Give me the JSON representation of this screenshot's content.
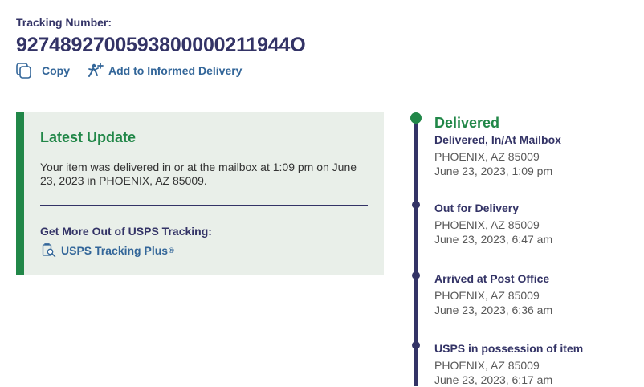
{
  "header": {
    "tracking_label": "Tracking Number:",
    "tracking_number": "9274892700593800000211944O",
    "copy_label": "Copy",
    "informed_label": "Add to Informed Delivery"
  },
  "latest_update": {
    "title": "Latest Update",
    "text": "Your item was delivered in or at the mailbox at 1:09 pm on June 23, 2023 in PHOENIX, AZ 85009.",
    "more_title": "Get More Out of USPS Tracking:",
    "plus_label": "USPS Tracking Plus",
    "plus_mark": "®"
  },
  "timeline": {
    "events": [
      {
        "status": "Delivered",
        "detail": "Delivered, In/At Mailbox",
        "location": "PHOENIX, AZ 85009",
        "datetime": "June 23, 2023, 1:09 pm"
      },
      {
        "status": "Out for Delivery",
        "location": "PHOENIX, AZ 85009",
        "datetime": "June 23, 2023, 6:47 am"
      },
      {
        "status": "Arrived at Post Office",
        "location": "PHOENIX, AZ 85009",
        "datetime": "June 23, 2023, 6:36 am"
      },
      {
        "status": "USPS in possession of item",
        "location": "PHOENIX, AZ 85009",
        "datetime": "June 23, 2023, 6:17 am"
      }
    ]
  },
  "colors": {
    "navy": "#333366",
    "green": "#218748",
    "link_blue": "#336699",
    "card_bg": "#e9efe9"
  },
  "icons": [
    "copy-icon",
    "informed-delivery-icon",
    "tracking-plus-icon"
  ]
}
